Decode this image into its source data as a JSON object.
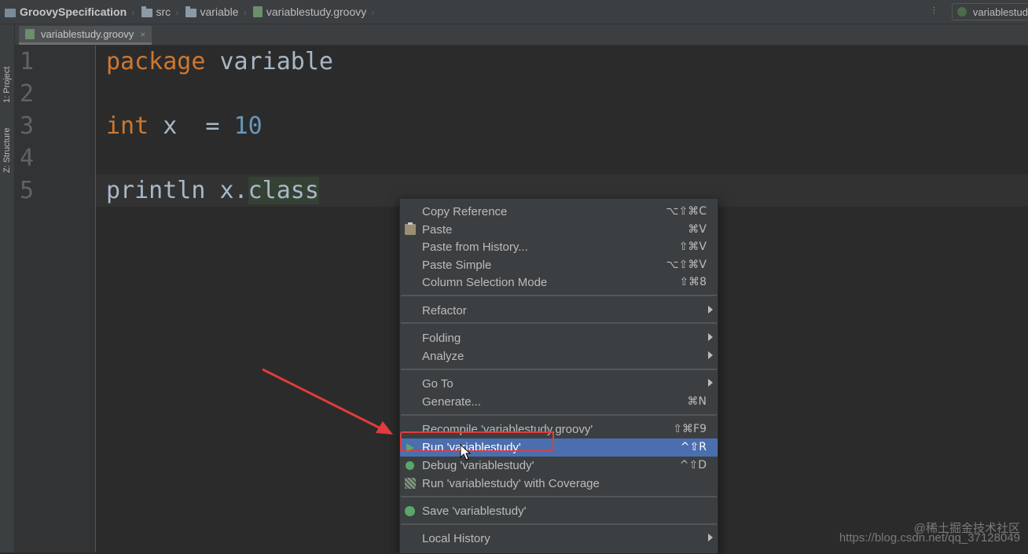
{
  "breadcrumb": {
    "project": "GroovySpecification",
    "items": [
      "src",
      "variable",
      "variablestudy.groovy"
    ]
  },
  "run_config": {
    "label": "variablestud"
  },
  "tool_windows": {
    "project": "1: Project",
    "structure": "Z: Structure"
  },
  "editor_tab": {
    "label": "variablestudy.groovy",
    "close": "×"
  },
  "editor": {
    "line_numbers": [
      "1",
      "2",
      "3",
      "4",
      "5"
    ],
    "lines": {
      "l1_kw": "package",
      "l1_rest": " variable",
      "l3_kw": "int",
      "l3_mid": " x  = ",
      "l3_num": "10",
      "l5_a": "println x.",
      "l5_b": "class"
    }
  },
  "context_menu": {
    "copy_reference": {
      "label": "Copy Reference",
      "shortcut": "⌥⇧⌘C"
    },
    "paste": {
      "label": "Paste",
      "shortcut": "⌘V"
    },
    "paste_from_history": {
      "label": "Paste from History...",
      "shortcut": "⇧⌘V"
    },
    "paste_simple": {
      "label": "Paste Simple",
      "shortcut": "⌥⇧⌘V"
    },
    "column_selection": {
      "label": "Column Selection Mode",
      "shortcut": "⇧⌘8"
    },
    "refactor": {
      "label": "Refactor"
    },
    "folding": {
      "label": "Folding"
    },
    "analyze": {
      "label": "Analyze"
    },
    "go_to": {
      "label": "Go To"
    },
    "generate": {
      "label": "Generate...",
      "shortcut": "⌘N"
    },
    "recompile": {
      "label": "Recompile 'variablestudy.groovy'",
      "shortcut": "⇧⌘F9"
    },
    "run": {
      "label": "Run 'variablestudy'",
      "shortcut": "^⇧R"
    },
    "debug": {
      "label": "Debug 'variablestudy'",
      "shortcut": "^⇧D"
    },
    "run_coverage": {
      "label": "Run 'variablestudy' with Coverage"
    },
    "save": {
      "label": "Save 'variablestudy'"
    },
    "local_history": {
      "label": "Local History"
    }
  },
  "watermark": {
    "line1": "@稀土掘金技术社区",
    "line2": "https://blog.csdn.net/qq_37128049"
  },
  "colors": {
    "keyword": "#cc7832",
    "number": "#6897bb",
    "selection": "#4b6eaf",
    "annotation_red": "#e23b3b"
  }
}
